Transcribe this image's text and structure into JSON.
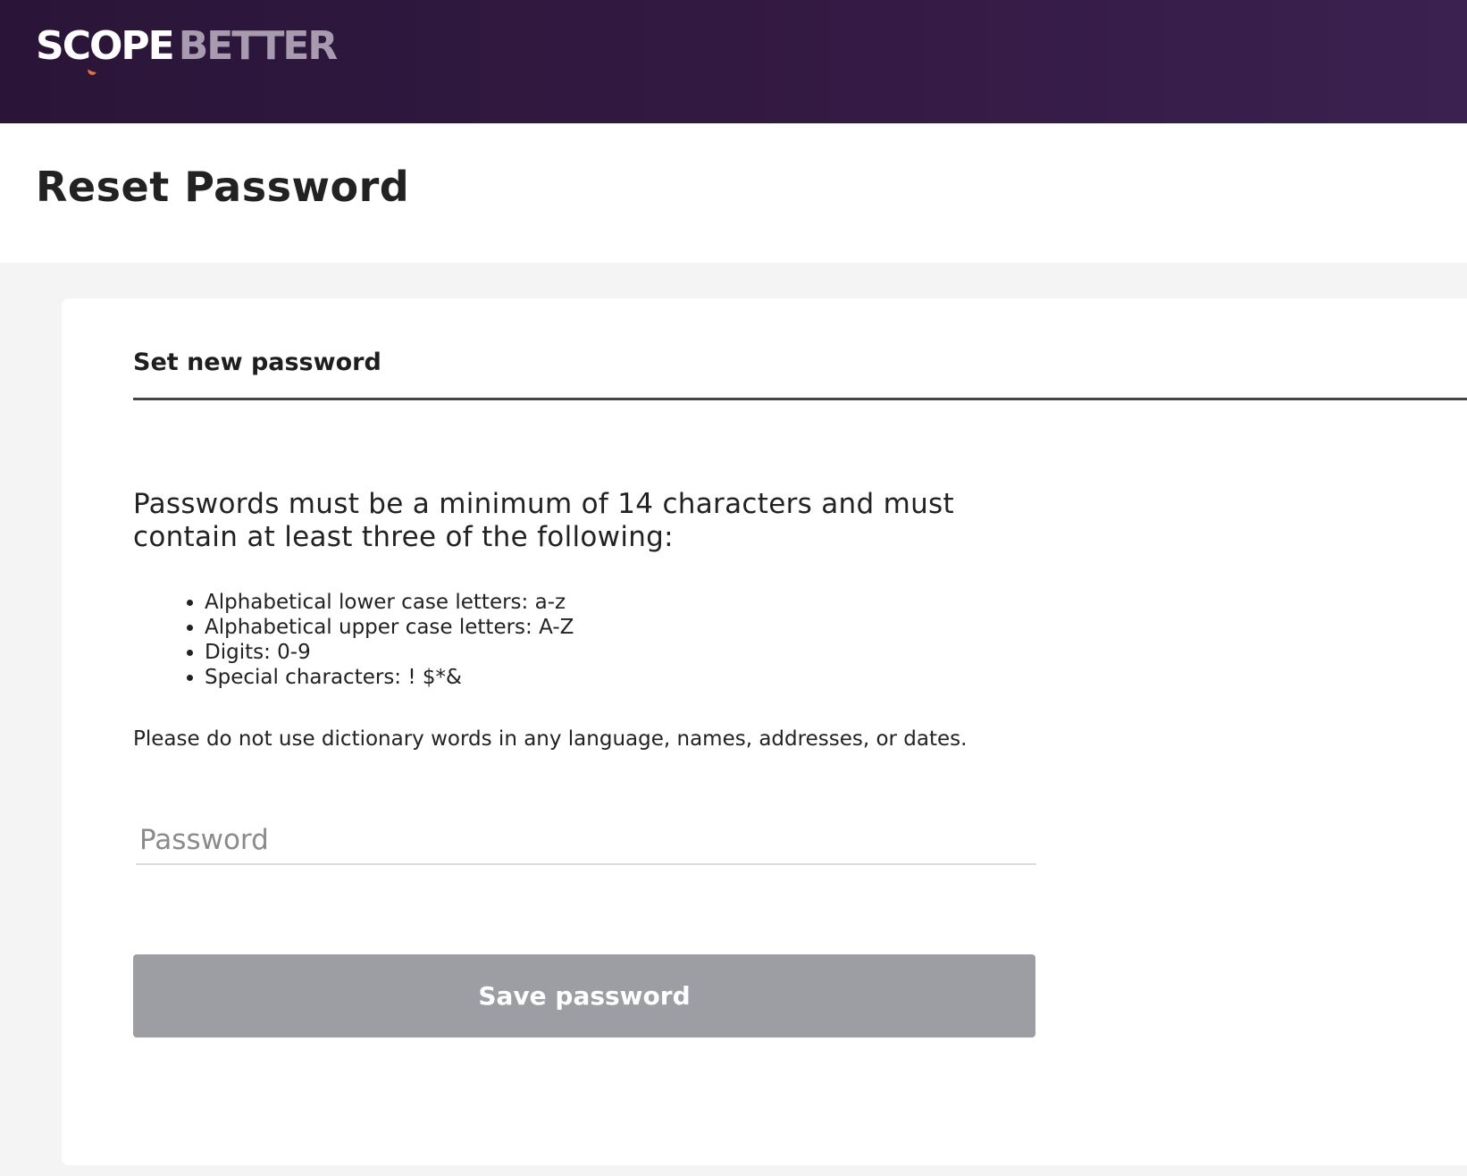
{
  "header": {
    "logo_primary": "SCOPE",
    "logo_secondary": "BETTER"
  },
  "page": {
    "title": "Reset Password"
  },
  "form": {
    "heading": "Set new password",
    "intro": "Passwords must be a minimum of 14 characters and must contain at least three of the following:",
    "requirements": [
      "Alphabetical lower case letters: a-z",
      "Alphabetical upper case letters: A-Z",
      "Digits: 0-9",
      "Special characters: ! $*&"
    ],
    "note": "Please do not use dictionary words in any language, names, addresses, or dates.",
    "password_placeholder": "Password",
    "password_value": "",
    "save_label": "Save password"
  },
  "colors": {
    "header_bg": "#2e1840",
    "logo_accent": "#e8743b",
    "button_disabled_bg": "#9d9ea3",
    "heading_rule": "#444447"
  }
}
